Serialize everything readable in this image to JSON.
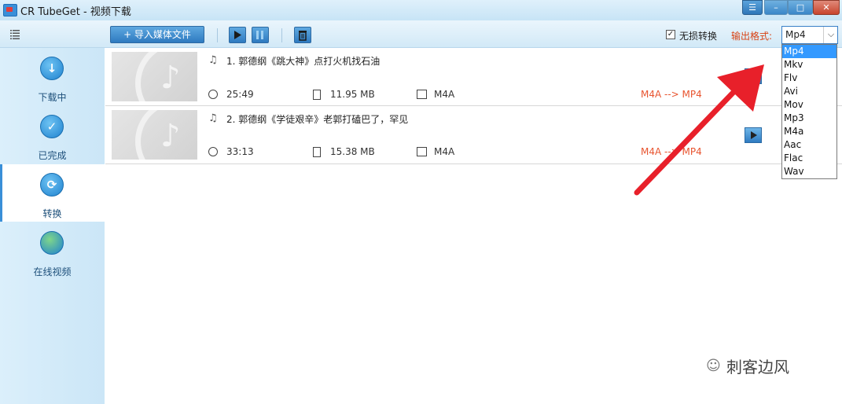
{
  "window": {
    "title": "CR TubeGet - 视频下载",
    "buttons": {
      "menu": "☰",
      "minimize": "–",
      "maximize": "□",
      "close": "✕"
    }
  },
  "toolbar": {
    "import_label": "+ 导入媒体文件",
    "lossless_label": "无损转换",
    "lossless_checked": true,
    "format_label": "输出格式:",
    "format_value": "Mp4",
    "format_options": [
      "Mp4",
      "Mkv",
      "Flv",
      "Avi",
      "Mov",
      "Mp3",
      "M4a",
      "Aac",
      "Flac",
      "Wav"
    ]
  },
  "sidebar": {
    "items": [
      {
        "label": "下载中",
        "icon": "download-icon",
        "glyph": "↓",
        "active": false
      },
      {
        "label": "已完成",
        "icon": "check-icon",
        "glyph": "✓",
        "active": false
      },
      {
        "label": "转换",
        "icon": "convert-icon",
        "glyph": "⟳",
        "active": true
      },
      {
        "label": "在线视频",
        "icon": "globe-icon",
        "glyph": "●",
        "active": false
      }
    ]
  },
  "items": [
    {
      "title": "1. 郭德纲《跳大神》点打火机找石油",
      "duration": "25:49",
      "size": "11.95 MB",
      "format": "M4A",
      "conversion": "M4A --> MP4"
    },
    {
      "title": "2. 郭德纲《学徒艰辛》老郭打磕巴了，罕见",
      "duration": "33:13",
      "size": "15.38 MB",
      "format": "M4A",
      "conversion": "M4A --> MP4"
    }
  ],
  "watermark": {
    "text": "刺客边风"
  },
  "colors": {
    "accent": "#3a8fd8",
    "conversion": "#e8542f",
    "arrow": "#e8202a",
    "selected": "#3399ff"
  }
}
